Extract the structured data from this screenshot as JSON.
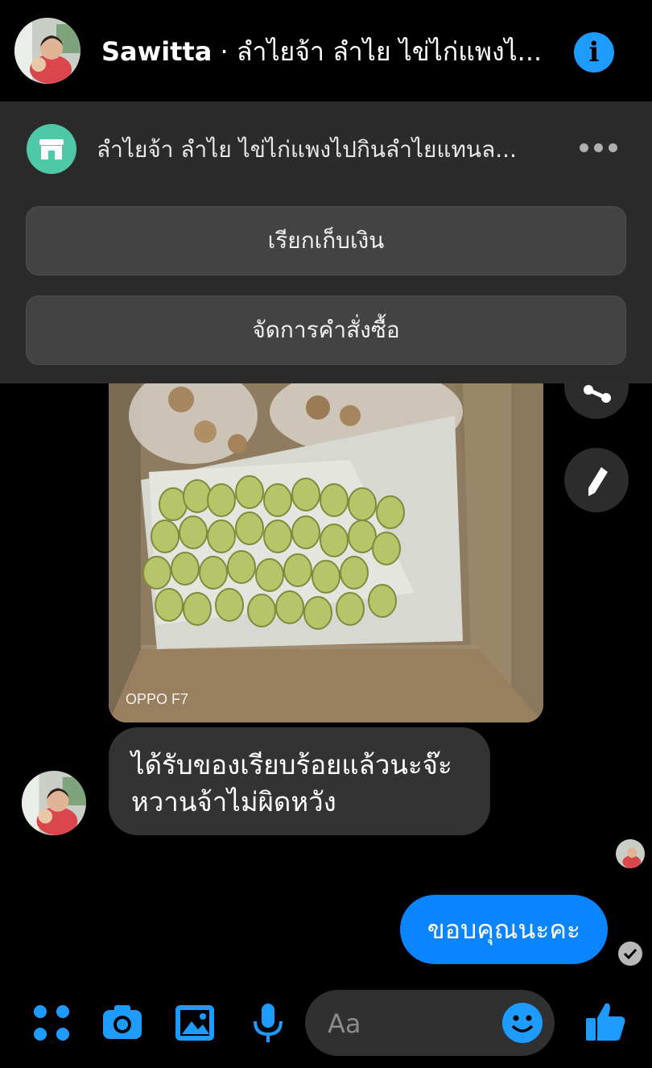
{
  "header": {
    "contact_name": "Sawitta",
    "separator": " · ",
    "page_name": "ลำไยจ้า ลำไย ไข่ไก่แพงไ...",
    "avatar_icon": "contact-avatar",
    "info_icon": "info-icon"
  },
  "business_panel": {
    "page_name": "ลำไยจ้า ลำไย ไข่ไก่แพงไปกินลำไยแทนล...",
    "request_payment_label": "เรียกเก็บเงิน",
    "manage_orders_label": "จัดการคำสั่งซื้อ"
  },
  "conversation": {
    "photo_watermark": "OPPO F7",
    "incoming_message_line1": "ได้รับของเรียบร้อยแล้วนะจ๊ะ",
    "incoming_message_line2": "หวานจ้าไม่ผิดหวัง",
    "outgoing_message": "ขอบคุณนะคะ"
  },
  "composer": {
    "placeholder": "Aa"
  },
  "colors": {
    "accent": "#0b84ff",
    "icon_blue": "#1e9bff",
    "panel_bg": "#2b2b2b",
    "button_bg": "#434343",
    "incoming_bubble": "#333333",
    "shop_icon_bg": "#4fc8a7"
  }
}
